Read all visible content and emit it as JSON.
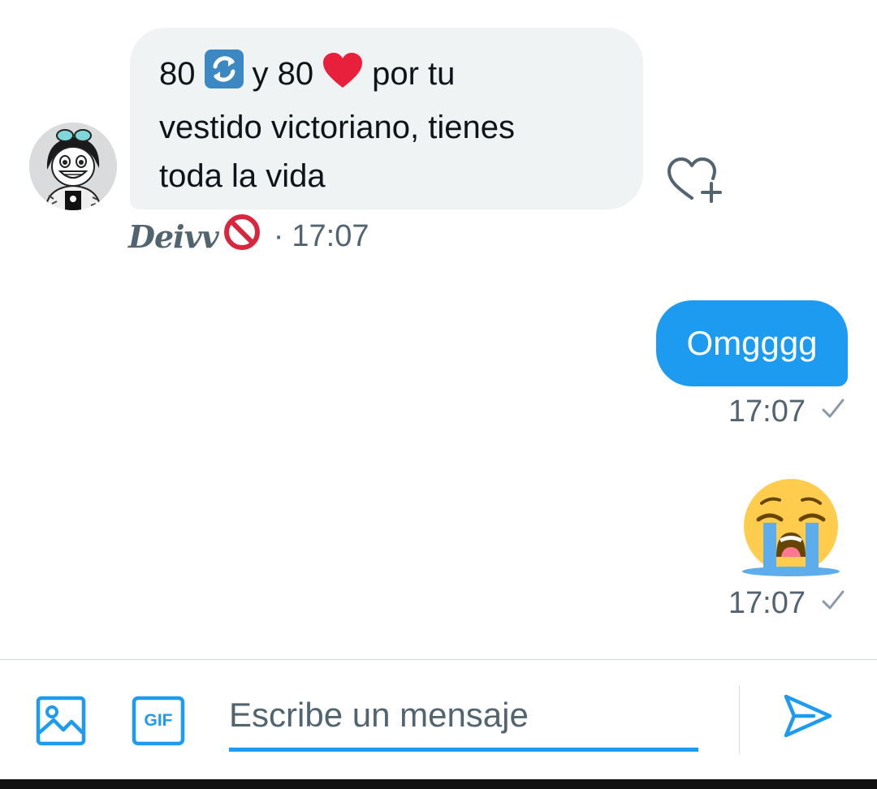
{
  "colors": {
    "accent": "#1d9bf0",
    "incoming_bubble": "#eff3f4",
    "muted_text": "#536471",
    "heart": "#e8203c",
    "prohibited": "#d7263d"
  },
  "messages": [
    {
      "direction": "incoming",
      "lines": [
        {
          "before": "80",
          "emoji": "repeat-button-emoji",
          "middle": "y 80",
          "emoji2": "red-heart-emoji",
          "after": "por tu"
        },
        {
          "text": "vestido victoriano, tienes"
        },
        {
          "text": "toda la vida"
        }
      ],
      "sender": "Deivv",
      "sender_emoji": "prohibited-emoji",
      "separator": "·",
      "time": "17:07"
    },
    {
      "direction": "outgoing",
      "text": "Omgggg",
      "time": "17:07",
      "status": "sent-check-icon"
    },
    {
      "direction": "outgoing",
      "emoji": "loudly-crying-face-emoji",
      "time": "17:07",
      "status": "sent-check-icon"
    }
  ],
  "composer": {
    "placeholder": "Escribe un mensaje",
    "value": "",
    "gif_label": "GIF",
    "icons": [
      "image-icon",
      "gif-icon",
      "send-icon"
    ]
  }
}
